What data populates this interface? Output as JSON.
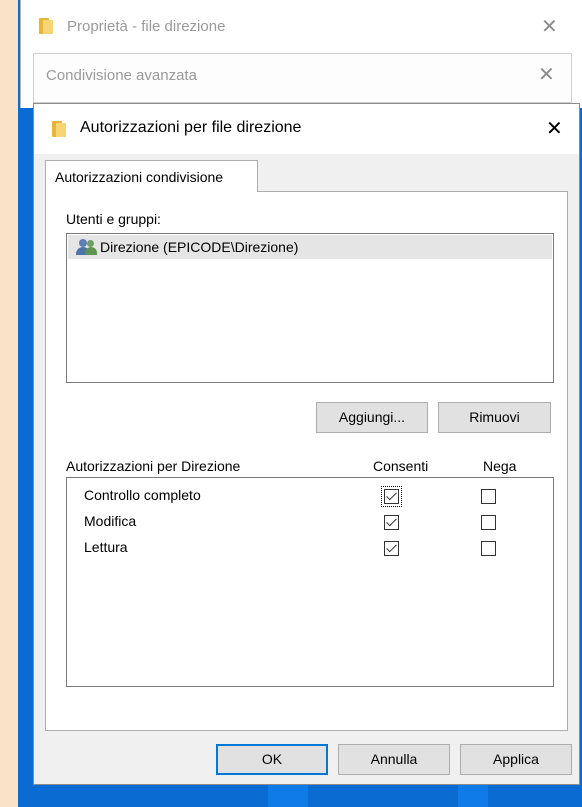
{
  "window_properties": {
    "title": "Proprietà - file direzione"
  },
  "window_advanced": {
    "title": "Condivisione avanzata"
  },
  "dialog": {
    "title": "Autorizzazioni per file direzione",
    "tab_label": "Autorizzazioni condivisione",
    "users_label": "Utenti e gruppi:",
    "users": [
      {
        "name": "Direzione (EPICODE\\Direzione)",
        "icon": "users-group-icon",
        "selected": true
      }
    ],
    "add_button": "Aggiungi...",
    "remove_button": "Rimuovi",
    "permissions_header": "Autorizzazioni per Direzione",
    "allow_header": "Consenti",
    "deny_header": "Nega",
    "permissions": [
      {
        "label": "Controllo completo",
        "allow": true,
        "deny": false
      },
      {
        "label": "Modifica",
        "allow": true,
        "deny": false
      },
      {
        "label": "Lettura",
        "allow": true,
        "deny": false
      }
    ],
    "ok_button": "OK",
    "cancel_button": "Annulla",
    "apply_button": "Applica"
  },
  "colors": {
    "desktop": "#0a6cd3",
    "background": "#f9e2c8",
    "accent": "#0078d7"
  }
}
